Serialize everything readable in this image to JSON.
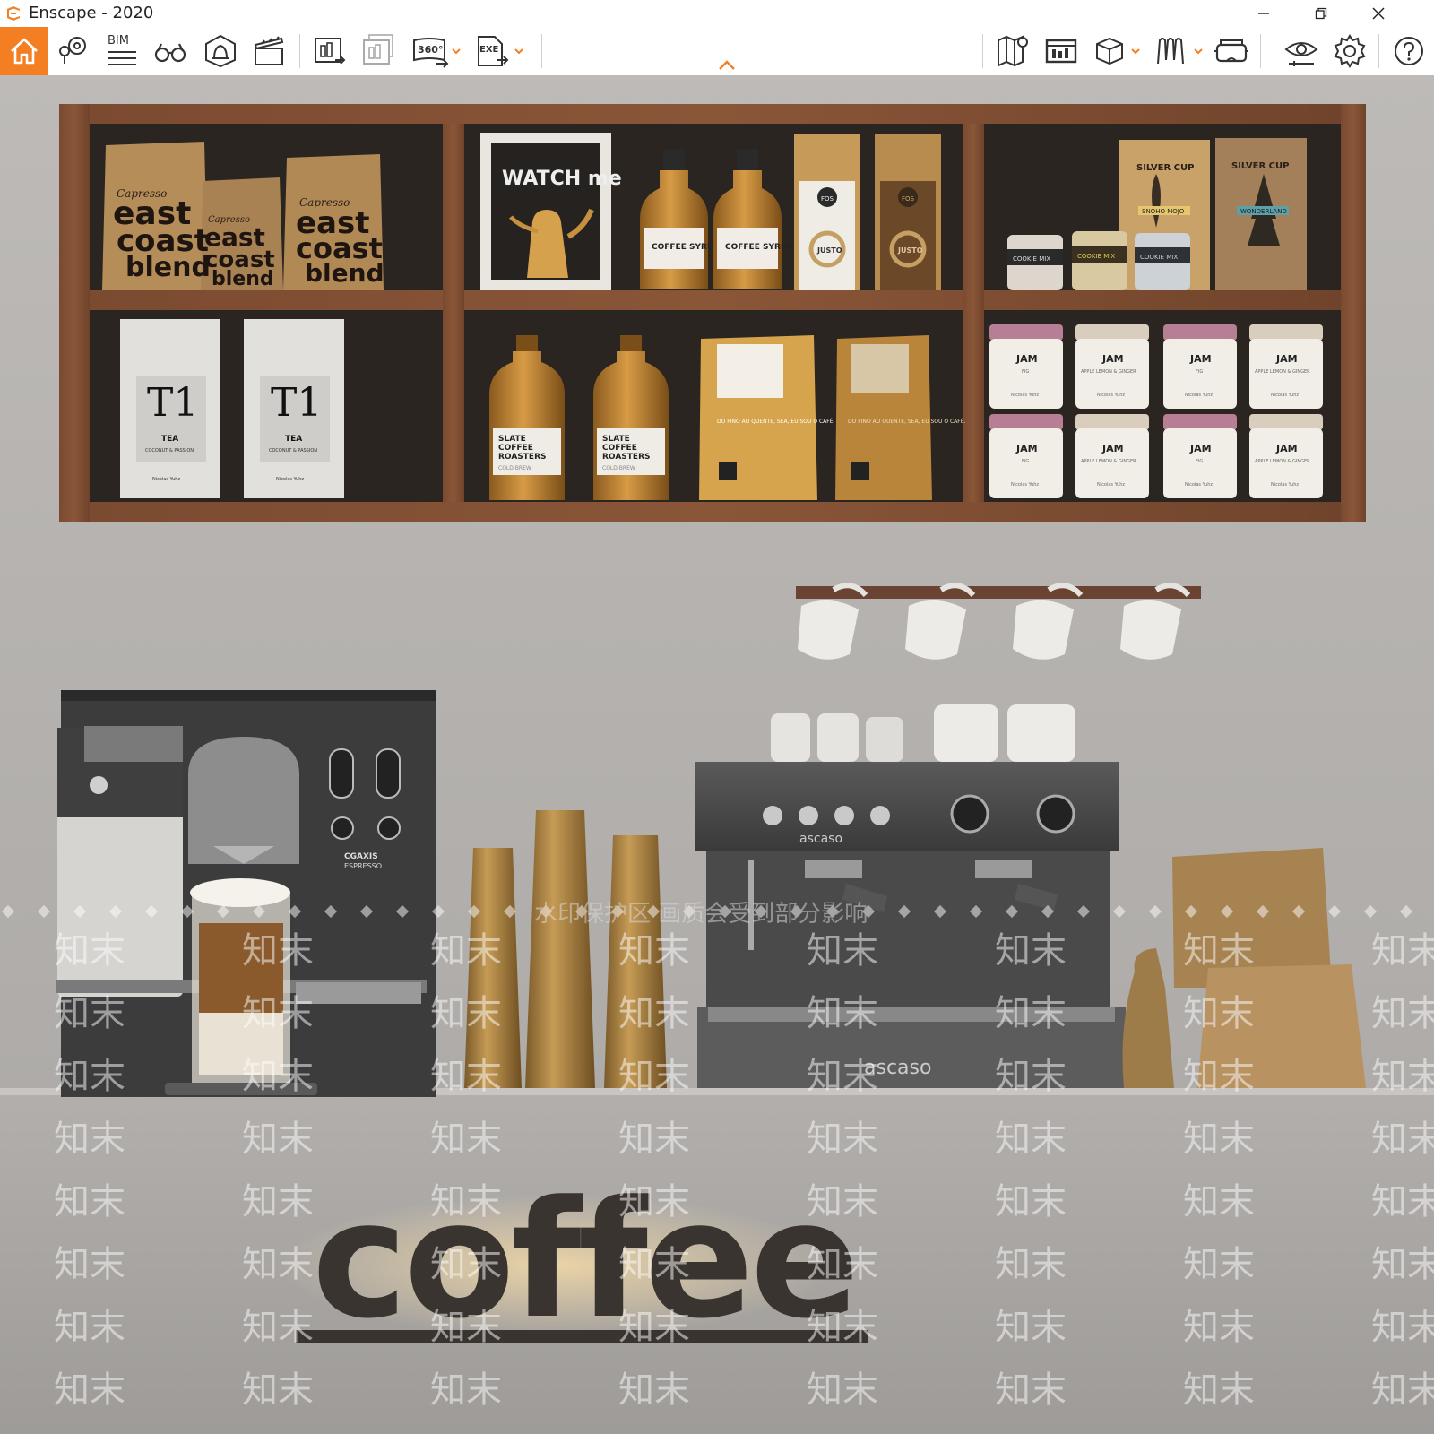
{
  "window": {
    "title": "Enscape - 2020",
    "controls": [
      "minimize",
      "restore",
      "close"
    ]
  },
  "toolbar": {
    "left_icons": [
      "home-icon",
      "map-pin-icon",
      "bim-icon",
      "binoculars-icon",
      "asset-bell-icon",
      "clapper-icon",
      "export-image-icon",
      "batch-render-icon",
      "export-360-icon",
      "export-exe-icon"
    ],
    "right_icons": [
      "map-icon",
      "presentation-icon",
      "cube-icon",
      "materials-icon",
      "vr-headset-icon",
      "visual-settings-icon",
      "settings-gear-icon",
      "help-icon"
    ],
    "bim_label": "BIM",
    "pano_label": "360°",
    "exe_label": "EXE",
    "accent_color": "#f47f22"
  },
  "scene": {
    "left_bags": {
      "brand": "Capresso",
      "line1": "east",
      "line2": "coast",
      "line3": "blend"
    },
    "poster": "WATCH me",
    "syrup_label": "COFFEE SYRUP",
    "jusio_label": "JUSTO",
    "fos_label": "FOS",
    "silver_cup": "SILVER CUP",
    "snoho": "SNOHO MOJO",
    "wonderland": "WONDERLAND",
    "cookie": "COOKIE MIX",
    "tea_title": "T1",
    "tea_sub": "TEA",
    "tea_desc": "COCONUT & PASSION",
    "tea_author": "Nicolas Yuhz",
    "roaster_lines": [
      "SLATE",
      "COFFEE",
      "ROASTERS"
    ],
    "roaster_sub": "COLD BREW",
    "bag_text": "DO FINO AO QUENTE, SEA, EU SOU O CAFÉ.",
    "jam_label": "JAM",
    "jam_fig": "FIG",
    "jam_apple": "APPLE LEMON & GINGER",
    "jam_author": "Nicolas Yuhz",
    "machine_brand": "CGAXIS",
    "machine_sub": "ESPRESSO",
    "espresso_brand": "ascaso",
    "sign_word": "coffee",
    "watermark_banner": "水印保护区  画质会受到部分影响",
    "watermark_mark": "知末"
  }
}
